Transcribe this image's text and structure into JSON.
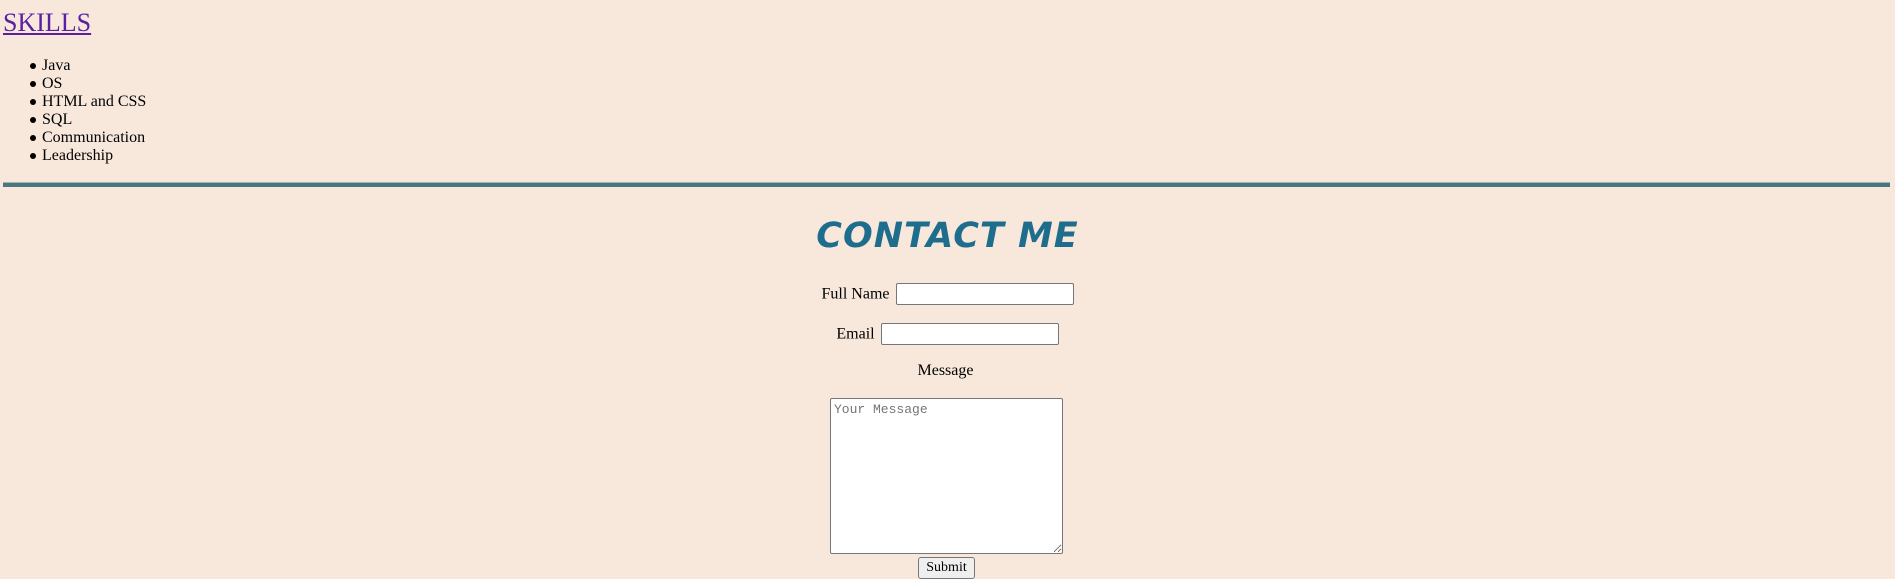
{
  "skills": {
    "title": "SKILLS",
    "items": [
      "Java",
      "OS",
      "HTML and CSS",
      "SQL",
      "Communication",
      "Leadership"
    ]
  },
  "contact": {
    "title": "CONTACT ME",
    "full_name_label": "Full Name",
    "full_name_value": "",
    "email_label": "Email",
    "email_value": "",
    "message_label": "Message",
    "message_placeholder": "Your Message",
    "submit_label": "Submit"
  },
  "colors": {
    "background": "#f8e8dc",
    "skills_link": "#5a1fa3",
    "divider": "#4b767c",
    "contact_title": "#1f6d8c"
  }
}
